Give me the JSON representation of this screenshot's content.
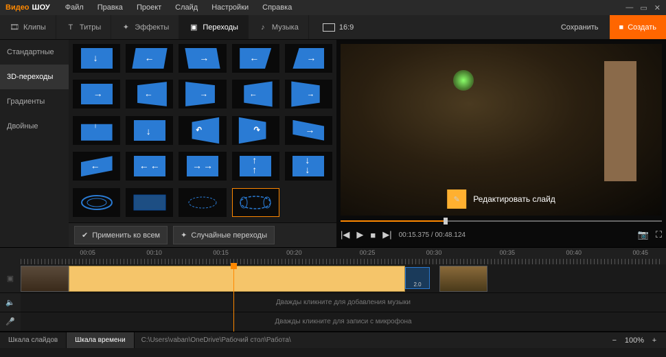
{
  "brand": {
    "a": "Видео",
    "b": "ШОУ"
  },
  "menu": [
    "Файл",
    "Правка",
    "Проект",
    "Слайд",
    "Настройки",
    "Справка"
  ],
  "tool_tabs": {
    "clips": "Клипы",
    "titles": "Титры",
    "effects": "Эффекты",
    "transitions": "Переходы",
    "music": "Музыка"
  },
  "aspect": "16:9",
  "actions": {
    "save": "Сохранить",
    "create": "Создать"
  },
  "sidebar": {
    "items": [
      "Стандартные",
      "3D-переходы",
      "Градиенты",
      "Двойные"
    ],
    "active_index": 1
  },
  "transition_actions": {
    "apply_all": "Применить ко всем",
    "random": "Случайные переходы"
  },
  "preview": {
    "edit_slide": "Редактировать слайд",
    "current_time": "00:15.375",
    "total_time": "00:48.124",
    "progress_pct": 32
  },
  "timeline": {
    "marks": [
      "00:05",
      "00:10",
      "00:15",
      "00:20",
      "00:25",
      "00:30",
      "00:35",
      "00:40",
      "00:45"
    ],
    "playhead_pct": 33,
    "transition_clip_label": "2.0",
    "music_placeholder": "Дважды кликните для добавления музыки",
    "mic_placeholder": "Дважды кликните для записи с микрофона"
  },
  "statusbar": {
    "tab_slides": "Шкала слайдов",
    "tab_time": "Шкала времени",
    "path": "C:\\Users\\vaban\\OneDrive\\Рабочий стол\\Работа\\",
    "zoom": "100%"
  }
}
